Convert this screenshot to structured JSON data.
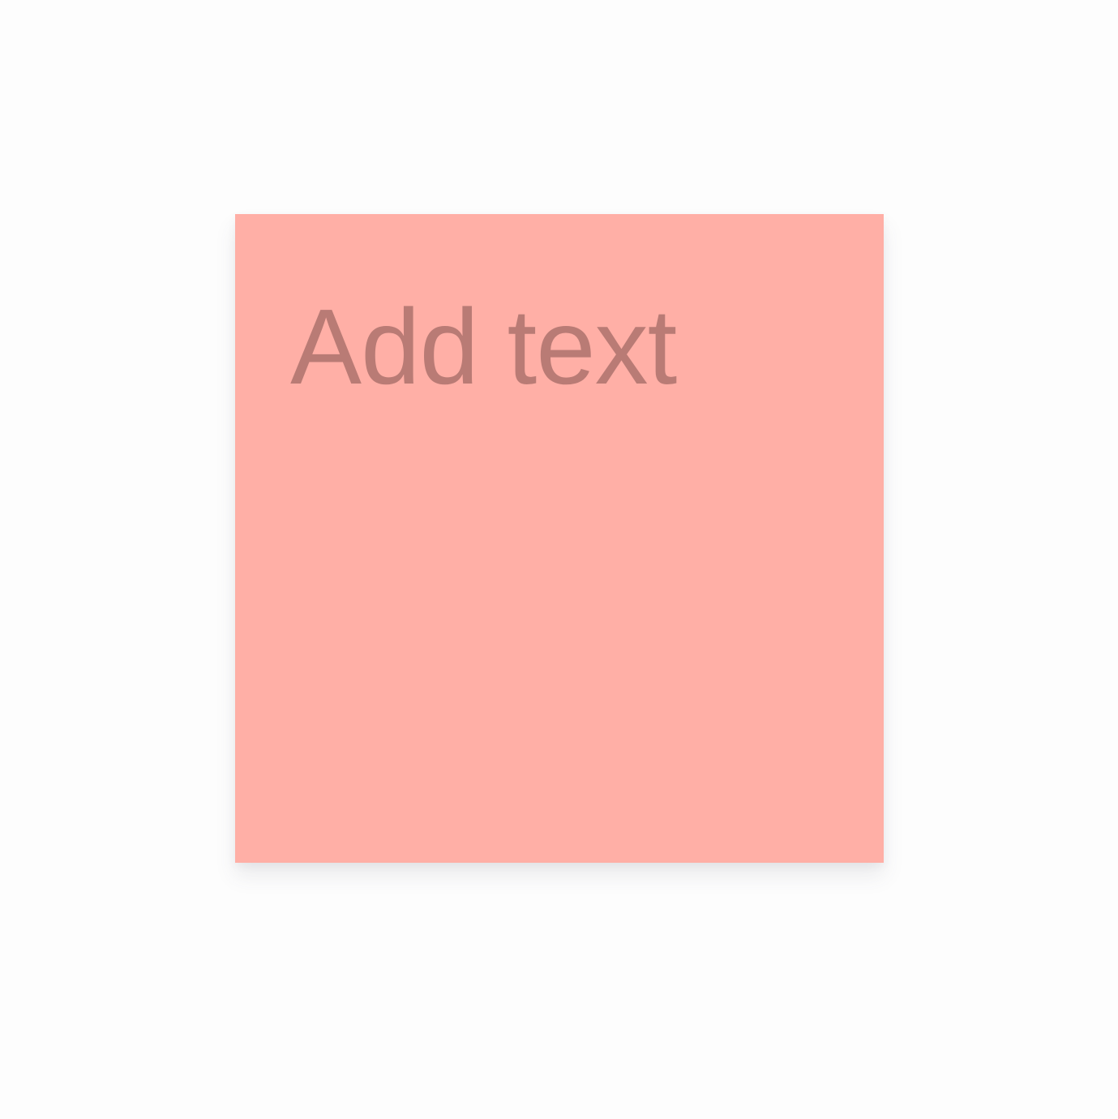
{
  "board": {
    "background_color": "#fdfdfd"
  },
  "sticky_note": {
    "placeholder": "Add text",
    "background_color": "#ffafa6",
    "text_color": "#b97b75"
  }
}
